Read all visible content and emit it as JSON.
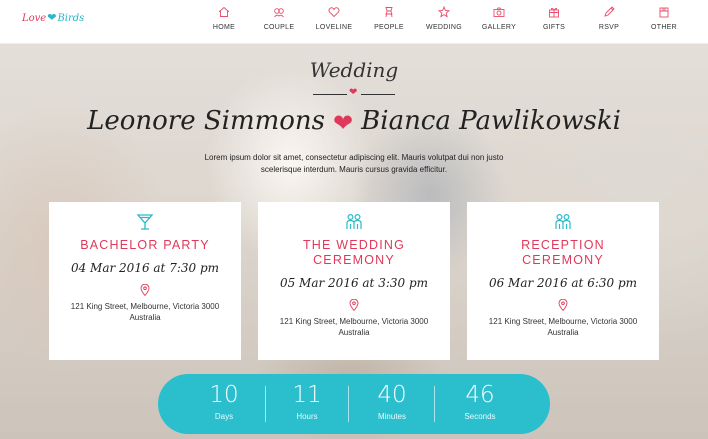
{
  "logo": {
    "word1": "Love",
    "word2": "Birds"
  },
  "nav": [
    {
      "label": "HOME",
      "icon": "home-icon"
    },
    {
      "label": "COUPLE",
      "icon": "couple-icon"
    },
    {
      "label": "LOVELINE",
      "icon": "heart-icon"
    },
    {
      "label": "PEOPLE",
      "icon": "people-icon"
    },
    {
      "label": "WEDDING",
      "icon": "star-icon"
    },
    {
      "label": "GALLERY",
      "icon": "camera-icon"
    },
    {
      "label": "GIFTS",
      "icon": "gift-icon"
    },
    {
      "label": "RSVP",
      "icon": "pen-icon"
    },
    {
      "label": "OTHER",
      "icon": "box-icon"
    }
  ],
  "hero": {
    "subtitle": "Wedding",
    "name1": "Leonore Simmons",
    "name2": "Bianca Pawlikowski",
    "intro": "Lorem ipsum dolor sit amet, consectetur adipiscing elit. Mauris volutpat dui non justo scelerisque interdum. Mauris cursus gravida efficitur."
  },
  "events": [
    {
      "title": "BACHELOR PARTY",
      "date": "04 Mar 2016 at 7:30 pm",
      "address": "121 King Street, Melbourne, Victoria 3000 Australia",
      "icon": "cocktail-icon"
    },
    {
      "title": "THE WEDDING CEREMONY",
      "date": "05 Mar 2016 at 3:30 pm",
      "address": "121 King Street, Melbourne, Victoria 3000 Australia",
      "icon": "couple-figures-icon"
    },
    {
      "title": "RECEPTION CEREMONY",
      "date": "06 Mar 2016 at 6:30 pm",
      "address": "121 King Street, Melbourne, Victoria 3000 Australia",
      "icon": "couple-figures-icon"
    }
  ],
  "countdown": [
    {
      "value": "10",
      "label": "Days"
    },
    {
      "value": "11",
      "label": "Hours"
    },
    {
      "value": "40",
      "label": "Minutes"
    },
    {
      "value": "46",
      "label": "Seconds"
    }
  ],
  "colors": {
    "accent": "#e0385a",
    "teal": "#2bbfcd"
  }
}
